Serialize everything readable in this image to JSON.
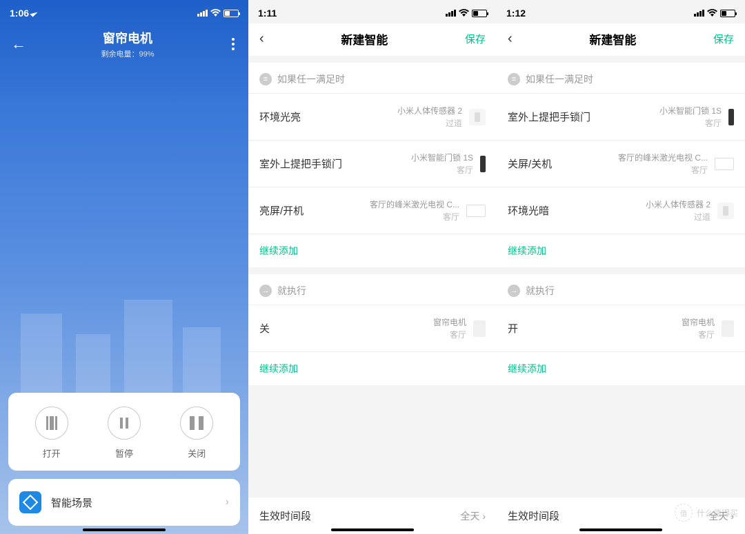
{
  "screen1": {
    "time": "1:06",
    "title": "窗帘电机",
    "subtitle": "剩余电量：99%",
    "controls": {
      "open": "打开",
      "pause": "暂停",
      "close": "关闭"
    },
    "scene_label": "智能场景"
  },
  "screen2": {
    "time": "1:11",
    "title": "新建智能",
    "save": "保存",
    "if_header": "如果任一满足时",
    "then_header": "就执行",
    "add_more": "继续添加",
    "if_rules": [
      {
        "action": "环境光亮",
        "device": "小米人体传感器 2",
        "location": "过道",
        "icon": "sensor"
      },
      {
        "action": "室外上提把手锁门",
        "device": "小米智能门锁 1S",
        "location": "客厅",
        "icon": "lock"
      },
      {
        "action": "亮屏/开机",
        "device": "客厅的峰米激光电视 C...",
        "location": "客厅",
        "icon": "tv"
      }
    ],
    "then_rules": [
      {
        "action": "关",
        "device": "窗帘电机",
        "location": "客厅",
        "icon": "curtain"
      }
    ],
    "time_label": "生效时间段",
    "time_value": "全天"
  },
  "screen3": {
    "time": "1:12",
    "title": "新建智能",
    "save": "保存",
    "if_header": "如果任一满足时",
    "then_header": "就执行",
    "add_more": "继续添加",
    "if_rules": [
      {
        "action": "室外上提把手锁门",
        "device": "小米智能门锁 1S",
        "location": "客厅",
        "icon": "lock"
      },
      {
        "action": "关屏/关机",
        "device": "客厅的峰米激光电视 C...",
        "location": "客厅",
        "icon": "tv"
      },
      {
        "action": "环境光暗",
        "device": "小米人体传感器 2",
        "location": "过道",
        "icon": "sensor"
      }
    ],
    "then_rules": [
      {
        "action": "开",
        "device": "窗帘电机",
        "location": "客厅",
        "icon": "curtain"
      }
    ],
    "time_label": "生效时间段",
    "time_value": "全天"
  },
  "watermark": "什么值得买"
}
